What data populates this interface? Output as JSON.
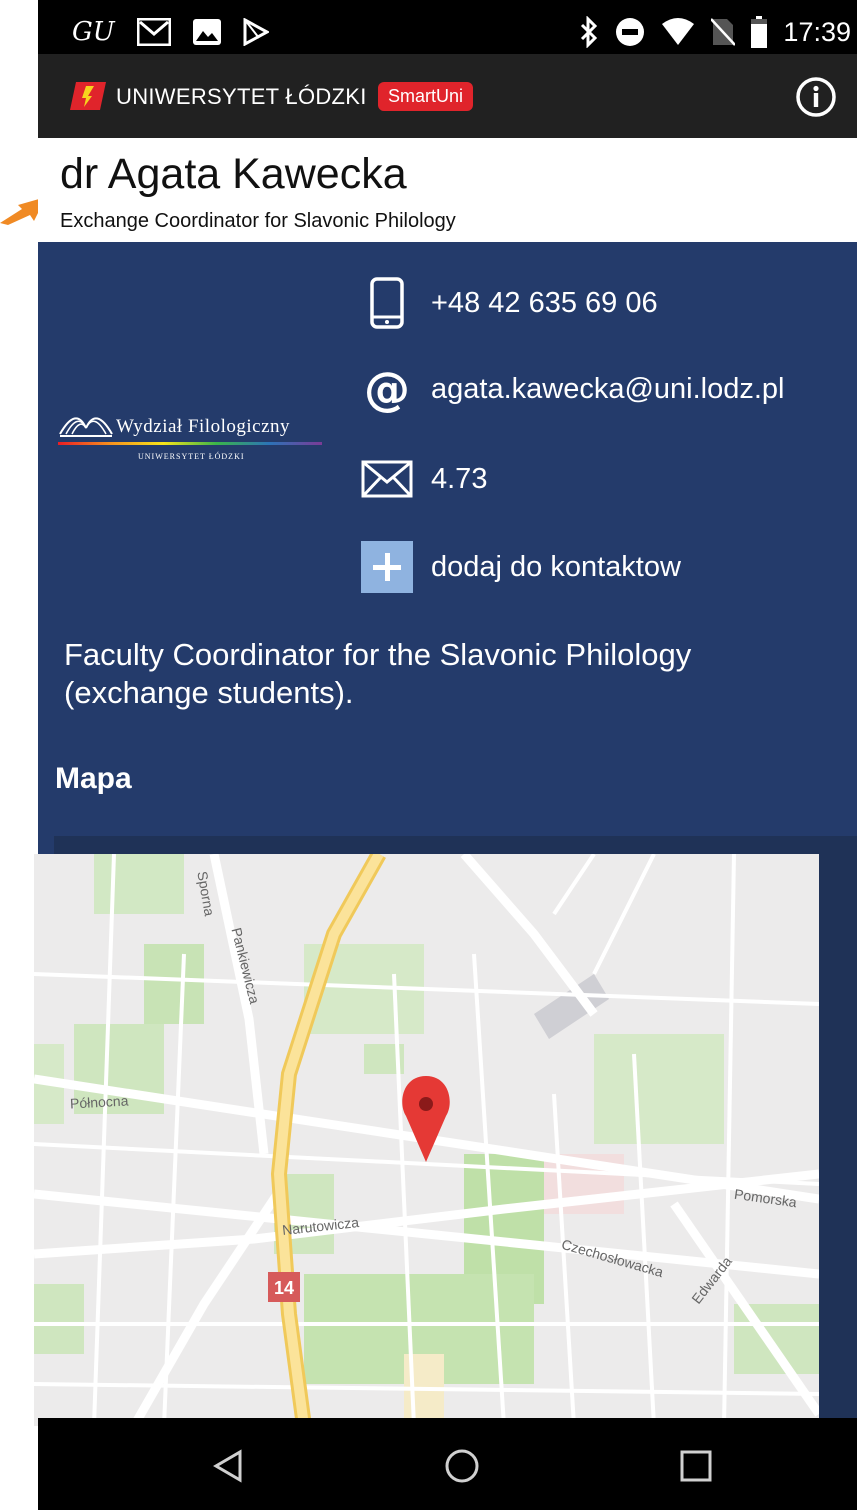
{
  "status_bar": {
    "carrier_icon_text": "GU",
    "time": "17:39"
  },
  "app_bar": {
    "university": "UNIWERSYTET ŁÓDZKI",
    "badge": "SmartUni"
  },
  "header": {
    "name": "dr Agata Kawecka",
    "title": "Exchange Coordinator for Slavonic Philology"
  },
  "faculty": {
    "name": "Wydział Filologiczny",
    "subtitle": "UNIWERSYTET ŁÓDZKI"
  },
  "contact": {
    "phone": "+48 42 635 69 06",
    "email": "agata.kawecka@uni.lodz.pl",
    "room": "4.73",
    "add_contact": "dodaj do kontaktow"
  },
  "description": "Faculty Coordinator for the Slavonic Philology (exchange students).",
  "map": {
    "heading": "Mapa",
    "streets": [
      "Sporna",
      "Pankiewicza",
      "Północna",
      "Narutowicza",
      "Pomorska",
      "Czechosłowacka",
      "Edwarda"
    ],
    "route_badge": "14"
  },
  "colors": {
    "background": "#243b6b",
    "accent_red": "#e0242b",
    "pin": "#e53935"
  },
  "icons": [
    "phone-icon",
    "at-icon",
    "envelope-icon",
    "plus-icon",
    "info-icon",
    "back-icon",
    "home-icon",
    "recents-icon",
    "map-pin-icon"
  ]
}
